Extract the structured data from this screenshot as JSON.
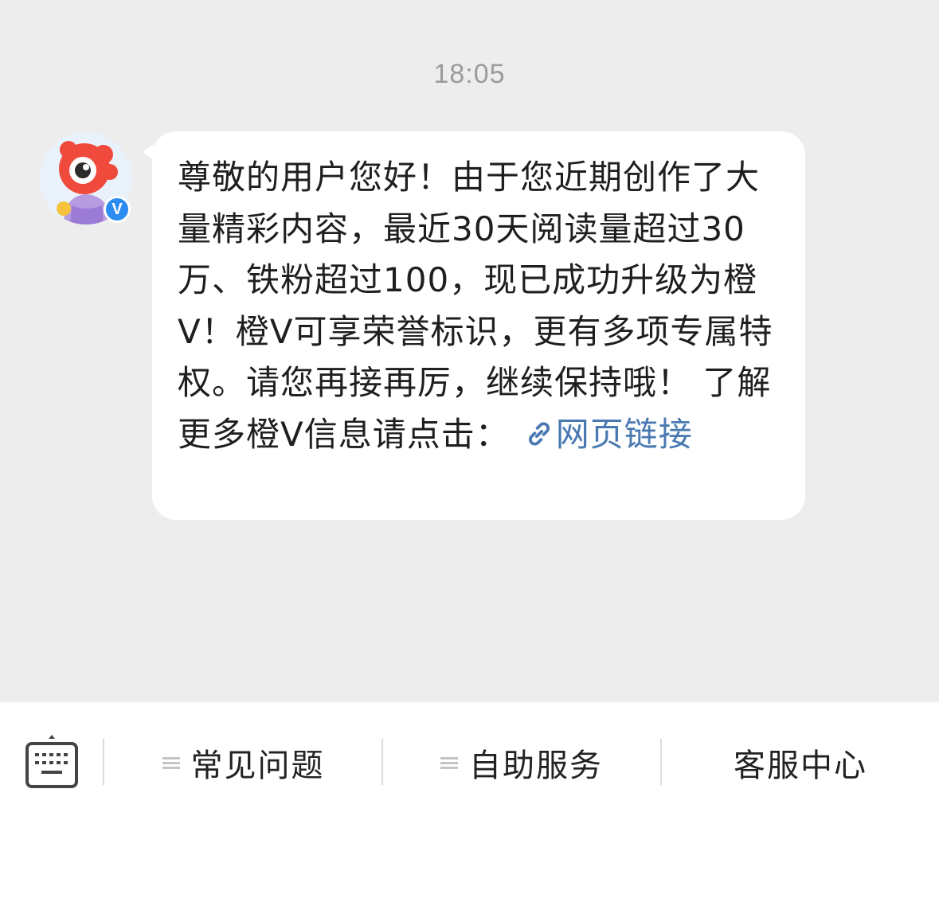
{
  "chat": {
    "timestamp": "18:05",
    "sender": {
      "verified_badge": "V"
    },
    "message": {
      "text": "尊敬的用户您好！由于您近期创作了大量精彩内容，最近30天阅读量超过30万、铁粉超过100，现已成功升级为橙V！橙V可享荣誉标识，更有多项专属特权。请您再接再厉，继续保持哦！ 了解更多橙V信息请点击：",
      "link_label": "网页链接",
      "link_icon": "link-icon"
    }
  },
  "bottom_menu": {
    "keyboard_icon": "keyboard-icon",
    "items": [
      {
        "label": "常见问题",
        "icon": "menu-lines-icon"
      },
      {
        "label": "自助服务",
        "icon": "menu-lines-icon"
      },
      {
        "label": "客服中心"
      }
    ]
  },
  "colors": {
    "chat_background": "#ededed",
    "bubble": "#ffffff",
    "link": "#4a79b2",
    "badge": "#2d8cf0",
    "timestamp": "#9b9b9b"
  }
}
